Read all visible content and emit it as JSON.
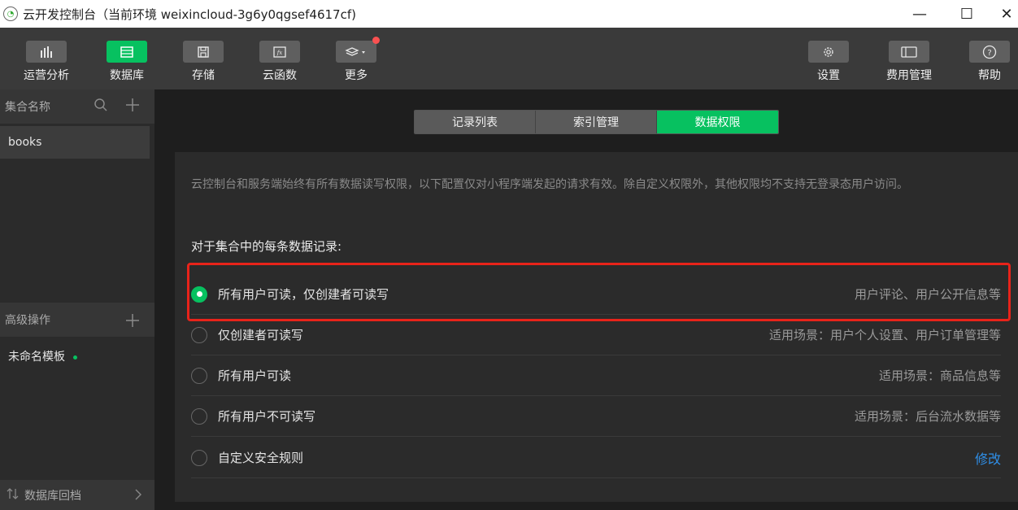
{
  "window": {
    "title": "云开发控制台（当前环境 weixincloud-3g6y0qgsef4617cf)",
    "minimize": "—",
    "maximize": "☐",
    "close": "✕"
  },
  "toolbar": {
    "left": [
      {
        "label": "运营分析",
        "icon": "bar-chart-icon",
        "glyph": "ıll"
      },
      {
        "label": "数据库",
        "icon": "database-icon",
        "glyph": "▤",
        "active": true
      },
      {
        "label": "存储",
        "icon": "save-icon",
        "glyph": "⛁"
      },
      {
        "label": "云函数",
        "icon": "function-icon",
        "glyph": "fx"
      },
      {
        "label": "更多",
        "icon": "layers-icon",
        "glyph": "◈ ▾",
        "badge": true
      }
    ],
    "right": [
      {
        "label": "设置",
        "icon": "gear-icon",
        "glyph": "⚙"
      },
      {
        "label": "费用管理",
        "icon": "billing-icon",
        "glyph": "▭"
      },
      {
        "label": "帮助",
        "icon": "help-icon",
        "glyph": "?"
      }
    ]
  },
  "sidebar": {
    "collections_header": "集合名称",
    "collections": [
      "books"
    ],
    "advanced_header": "高级操作",
    "templates": [
      "未命名模板"
    ],
    "footer": "数据库回档"
  },
  "tabs": [
    "记录列表",
    "索引管理",
    "数据权限"
  ],
  "active_tab": "数据权限",
  "permissions": {
    "notice": "云控制台和服务端始终有所有数据读写权限，以下配置仅对小程序端发起的请求有效。除自定义权限外，其他权限均不支持无登录态用户访问。",
    "section_title": "对于集合中的每条数据记录:",
    "options": [
      {
        "label": "所有用户可读，仅创建者可读写",
        "hint": "用户评论、用户公开信息等",
        "checked": true
      },
      {
        "label": "仅创建者可读写",
        "hint": "适用场景：用户个人设置、用户订单管理等",
        "checked": false
      },
      {
        "label": "所有用户可读",
        "hint": "适用场景：商品信息等",
        "checked": false
      },
      {
        "label": "所有用户不可读写",
        "hint": "适用场景：后台流水数据等",
        "checked": false
      },
      {
        "label": "自定义安全规则",
        "hint": "修改",
        "checked": false,
        "hint_is_link": true
      }
    ]
  },
  "colors": {
    "accent": "#07c160",
    "highlight": "#e8231a",
    "link": "#2f8fe8",
    "badge": "#fa5151"
  }
}
